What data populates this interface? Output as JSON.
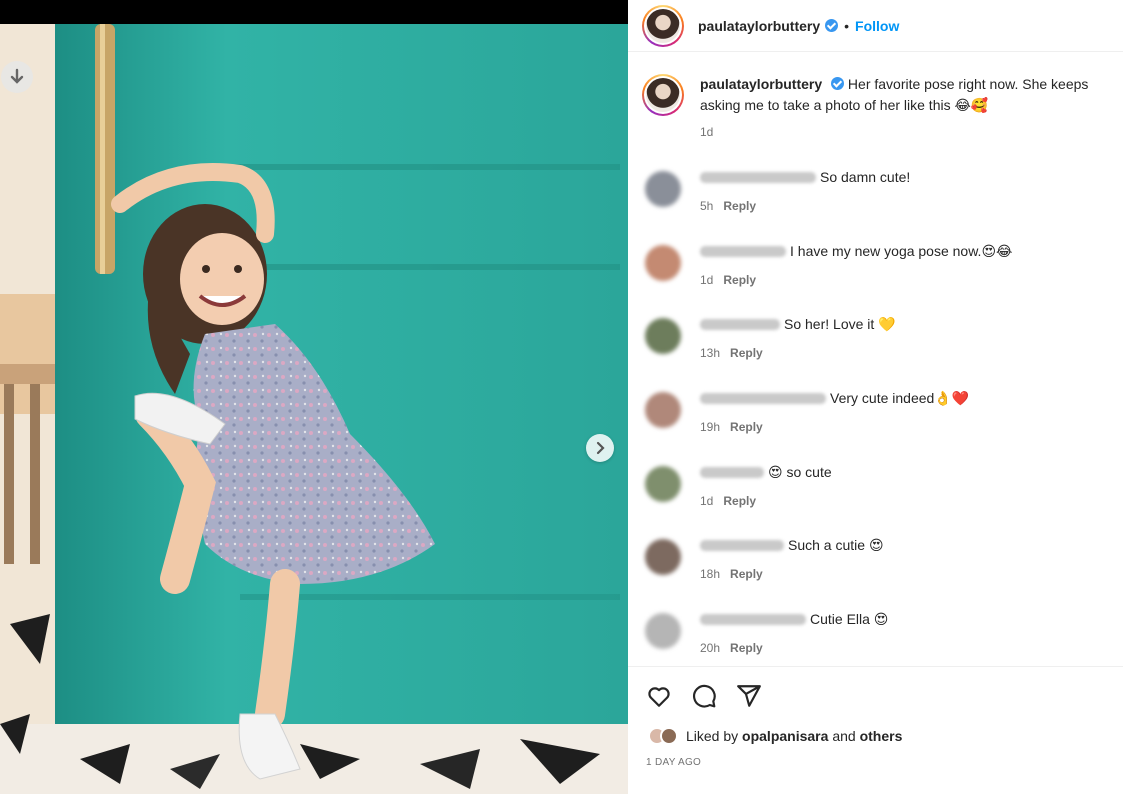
{
  "post": {
    "username": "paulataylorbuttery",
    "follow_label": "Follow",
    "separator": "•",
    "caption": "Her favorite pose right now. She keeps asking me to take a photo of her like this 😂🥰",
    "caption_time": "1d",
    "reply_label": "Reply"
  },
  "comments": [
    {
      "text": "So damn cute!",
      "time": "5h",
      "avatar_color": "#8a8f99"
    },
    {
      "text": "I have my new yoga pose now.😍😂",
      "time": "1d",
      "avatar_color": "#c48a72"
    },
    {
      "text": "So her! Love it 💛",
      "time": "13h",
      "avatar_color": "#6d7d5c"
    },
    {
      "text": "Very cute indeed👌❤️",
      "time": "19h",
      "avatar_color": "#b0887a"
    },
    {
      "text": "😍 so cute",
      "time": "1d",
      "avatar_color": "#7f8f6d"
    },
    {
      "text": "Such a cutie 😍",
      "time": "18h",
      "avatar_color": "#7d6a60"
    },
    {
      "text": "Cutie Ella 😍",
      "time": "20h",
      "avatar_color": "#b5b5b5"
    }
  ],
  "likes": {
    "prefix": "Liked by",
    "user": "opalpanisara",
    "connector": "and",
    "others": "others"
  },
  "posted_ago": "1 DAY AGO",
  "icons": {
    "download": "download-arrow-icon",
    "next": "chevron-right-icon",
    "like": "heart-icon",
    "comment": "comment-bubble-icon",
    "share": "paper-plane-icon",
    "verified": "verified-badge-icon"
  },
  "colors": {
    "accent": "#0095f6",
    "verified": "#3897f0",
    "muted": "#737373",
    "door": "#2aa89c"
  }
}
